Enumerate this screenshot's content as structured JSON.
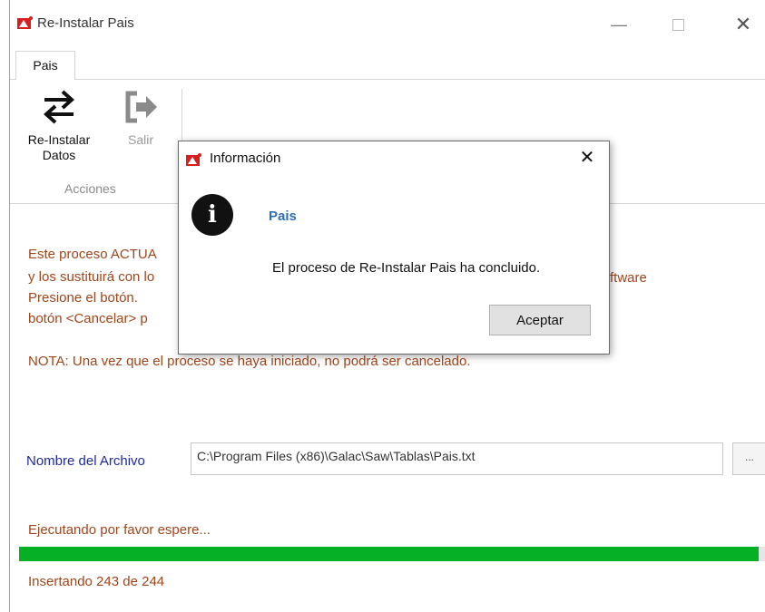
{
  "window": {
    "title": "Re-Instalar Pais",
    "minimize_glyph": "—",
    "close_glyph": "✕"
  },
  "tabs": [
    {
      "label": "Pais"
    }
  ],
  "ribbon": {
    "buttons": [
      {
        "label_line1": "Re-Instalar",
        "label_line2": "Datos",
        "icon": "swap-arrows-icon",
        "enabled": true
      },
      {
        "label": "Salir",
        "icon": "exit-icon",
        "enabled": false
      }
    ],
    "group_label": "Acciones"
  },
  "content": {
    "lines": [
      "Este proceso ACTUA",
      "y los sustituirá con lo",
      "Presione el botón.",
      "botón <Cancelar> p"
    ],
    "right_fragment": "ftware",
    "note": "NOTA: Una vez que el proceso se haya iniciado, no podrá ser cancelado.",
    "file_label": "Nombre del Archivo",
    "file_path": "C:\\Program Files (x86)\\Galac\\Saw\\Tablas\\Pais.txt",
    "browse_label": "...",
    "status": "Ejecutando por favor espere...",
    "progress_fraction": 0.99,
    "progress_text": "Insertando 243 de 244"
  },
  "dialog": {
    "title": "Información",
    "icon": "info-icon",
    "heading": "Pais",
    "message": "El proceso de Re-Instalar Pais ha concluido.",
    "ok_label": "Aceptar",
    "close_glyph": "✕"
  },
  "colors": {
    "body_text": "#a0461c",
    "file_label": "#1e2a9e",
    "dialog_heading": "#2d6fb7",
    "progress": "#06b025"
  }
}
